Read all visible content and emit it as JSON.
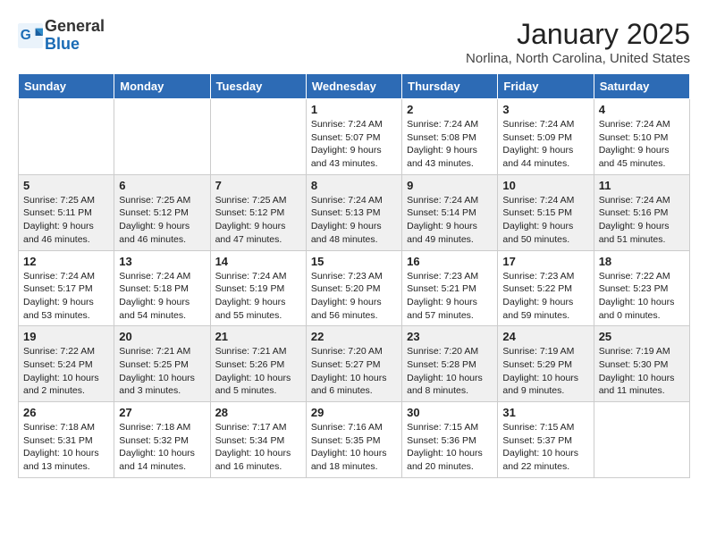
{
  "logo": {
    "general": "General",
    "blue": "Blue"
  },
  "title": "January 2025",
  "location": "Norlina, North Carolina, United States",
  "days_of_week": [
    "Sunday",
    "Monday",
    "Tuesday",
    "Wednesday",
    "Thursday",
    "Friday",
    "Saturday"
  ],
  "weeks": [
    [
      {
        "day": "",
        "detail": ""
      },
      {
        "day": "",
        "detail": ""
      },
      {
        "day": "",
        "detail": ""
      },
      {
        "day": "1",
        "detail": "Sunrise: 7:24 AM\nSunset: 5:07 PM\nDaylight: 9 hours and 43 minutes."
      },
      {
        "day": "2",
        "detail": "Sunrise: 7:24 AM\nSunset: 5:08 PM\nDaylight: 9 hours and 43 minutes."
      },
      {
        "day": "3",
        "detail": "Sunrise: 7:24 AM\nSunset: 5:09 PM\nDaylight: 9 hours and 44 minutes."
      },
      {
        "day": "4",
        "detail": "Sunrise: 7:24 AM\nSunset: 5:10 PM\nDaylight: 9 hours and 45 minutes."
      }
    ],
    [
      {
        "day": "5",
        "detail": "Sunrise: 7:25 AM\nSunset: 5:11 PM\nDaylight: 9 hours and 46 minutes."
      },
      {
        "day": "6",
        "detail": "Sunrise: 7:25 AM\nSunset: 5:12 PM\nDaylight: 9 hours and 46 minutes."
      },
      {
        "day": "7",
        "detail": "Sunrise: 7:25 AM\nSunset: 5:12 PM\nDaylight: 9 hours and 47 minutes."
      },
      {
        "day": "8",
        "detail": "Sunrise: 7:24 AM\nSunset: 5:13 PM\nDaylight: 9 hours and 48 minutes."
      },
      {
        "day": "9",
        "detail": "Sunrise: 7:24 AM\nSunset: 5:14 PM\nDaylight: 9 hours and 49 minutes."
      },
      {
        "day": "10",
        "detail": "Sunrise: 7:24 AM\nSunset: 5:15 PM\nDaylight: 9 hours and 50 minutes."
      },
      {
        "day": "11",
        "detail": "Sunrise: 7:24 AM\nSunset: 5:16 PM\nDaylight: 9 hours and 51 minutes."
      }
    ],
    [
      {
        "day": "12",
        "detail": "Sunrise: 7:24 AM\nSunset: 5:17 PM\nDaylight: 9 hours and 53 minutes."
      },
      {
        "day": "13",
        "detail": "Sunrise: 7:24 AM\nSunset: 5:18 PM\nDaylight: 9 hours and 54 minutes."
      },
      {
        "day": "14",
        "detail": "Sunrise: 7:24 AM\nSunset: 5:19 PM\nDaylight: 9 hours and 55 minutes."
      },
      {
        "day": "15",
        "detail": "Sunrise: 7:23 AM\nSunset: 5:20 PM\nDaylight: 9 hours and 56 minutes."
      },
      {
        "day": "16",
        "detail": "Sunrise: 7:23 AM\nSunset: 5:21 PM\nDaylight: 9 hours and 57 minutes."
      },
      {
        "day": "17",
        "detail": "Sunrise: 7:23 AM\nSunset: 5:22 PM\nDaylight: 9 hours and 59 minutes."
      },
      {
        "day": "18",
        "detail": "Sunrise: 7:22 AM\nSunset: 5:23 PM\nDaylight: 10 hours and 0 minutes."
      }
    ],
    [
      {
        "day": "19",
        "detail": "Sunrise: 7:22 AM\nSunset: 5:24 PM\nDaylight: 10 hours and 2 minutes."
      },
      {
        "day": "20",
        "detail": "Sunrise: 7:21 AM\nSunset: 5:25 PM\nDaylight: 10 hours and 3 minutes."
      },
      {
        "day": "21",
        "detail": "Sunrise: 7:21 AM\nSunset: 5:26 PM\nDaylight: 10 hours and 5 minutes."
      },
      {
        "day": "22",
        "detail": "Sunrise: 7:20 AM\nSunset: 5:27 PM\nDaylight: 10 hours and 6 minutes."
      },
      {
        "day": "23",
        "detail": "Sunrise: 7:20 AM\nSunset: 5:28 PM\nDaylight: 10 hours and 8 minutes."
      },
      {
        "day": "24",
        "detail": "Sunrise: 7:19 AM\nSunset: 5:29 PM\nDaylight: 10 hours and 9 minutes."
      },
      {
        "day": "25",
        "detail": "Sunrise: 7:19 AM\nSunset: 5:30 PM\nDaylight: 10 hours and 11 minutes."
      }
    ],
    [
      {
        "day": "26",
        "detail": "Sunrise: 7:18 AM\nSunset: 5:31 PM\nDaylight: 10 hours and 13 minutes."
      },
      {
        "day": "27",
        "detail": "Sunrise: 7:18 AM\nSunset: 5:32 PM\nDaylight: 10 hours and 14 minutes."
      },
      {
        "day": "28",
        "detail": "Sunrise: 7:17 AM\nSunset: 5:34 PM\nDaylight: 10 hours and 16 minutes."
      },
      {
        "day": "29",
        "detail": "Sunrise: 7:16 AM\nSunset: 5:35 PM\nDaylight: 10 hours and 18 minutes."
      },
      {
        "day": "30",
        "detail": "Sunrise: 7:15 AM\nSunset: 5:36 PM\nDaylight: 10 hours and 20 minutes."
      },
      {
        "day": "31",
        "detail": "Sunrise: 7:15 AM\nSunset: 5:37 PM\nDaylight: 10 hours and 22 minutes."
      },
      {
        "day": "",
        "detail": ""
      }
    ]
  ]
}
